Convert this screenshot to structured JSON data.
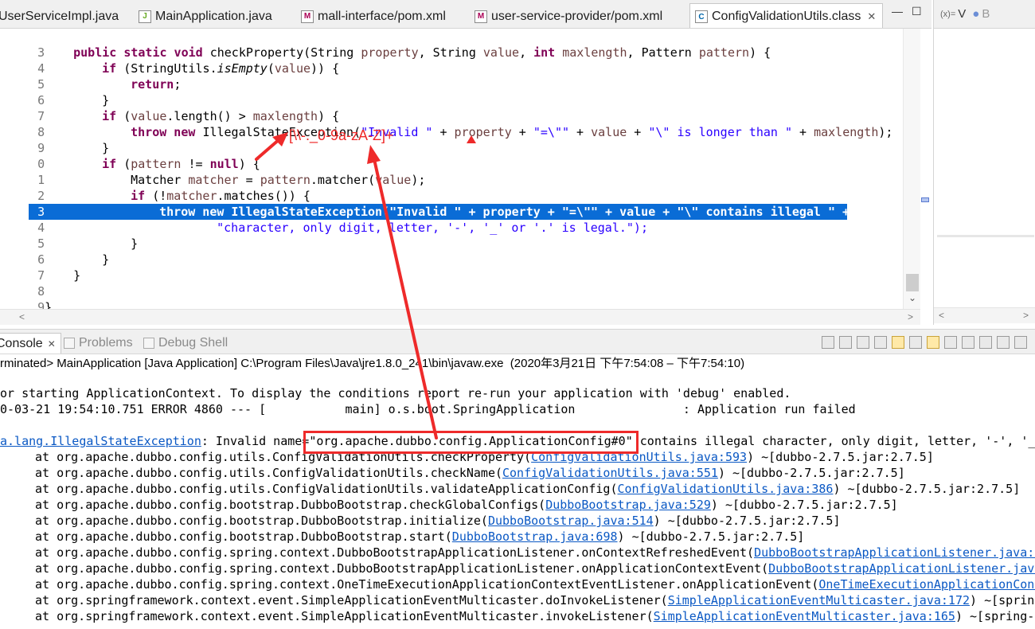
{
  "editor_tabs": [
    {
      "label": "UserServiceImpl.java",
      "icon": "java-file-icon"
    },
    {
      "label": "MainApplication.java",
      "icon": "java-file-icon"
    },
    {
      "label": "mall-interface/pom.xml",
      "icon": "xml-file-icon"
    },
    {
      "label": "user-service-provider/pom.xml",
      "icon": "xml-file-icon"
    },
    {
      "label": "ConfigValidationUtils.class",
      "icon": "class-file-icon",
      "active": true
    }
  ],
  "right_panel": {
    "tabs": [
      {
        "label": "V",
        "icon": "variables-icon"
      },
      {
        "label": "B",
        "icon": "breakpoints-icon"
      }
    ]
  },
  "code": {
    "line_numbers": [
      "3",
      "4",
      "5",
      "6",
      "7",
      "8",
      "9",
      "0",
      "1",
      "2",
      "3",
      "4",
      "5",
      "6",
      "7",
      "8",
      "9",
      ""
    ],
    "l0_a": "public static void ",
    "l0_b": "checkProperty(String ",
    "l0_c": "property",
    "l0_d": ", String ",
    "l0_e": "value",
    "l0_f": ", ",
    "l0_g": "int ",
    "l0_h": "maxlength",
    "l0_i": ", Pattern ",
    "l0_j": "pattern",
    "l0_k": ") {",
    "l1_a": "if ",
    "l1_b": "(StringUtils.",
    "l1_c": "isEmpty",
    "l1_d": "(",
    "l1_e": "value",
    "l1_f": ")) {",
    "l2_a": "return",
    "l2_b": ";",
    "l3": "}",
    "l4_a": "if ",
    "l4_b": "(",
    "l4_c": "value",
    "l4_d": ".length() > ",
    "l4_e": "maxlength",
    "l4_f": ") {",
    "l5_a": "throw new ",
    "l5_b": "IllegalStateException(",
    "l5_c": "\"Invalid \"",
    "l5_d": " + ",
    "l5_e": "property",
    "l5_f": " + ",
    "l5_g": "\"=\\\"\"",
    "l5_h": " + ",
    "l5_i": "value",
    "l5_j": " + ",
    "l5_k": "\"\\\" is longer than \"",
    "l5_l": " + ",
    "l5_m": "maxlength",
    "l5_n": ");",
    "l6": "}",
    "l7_a": "if ",
    "l7_b": "(",
    "l7_c": "pattern",
    "l7_d": " != ",
    "l7_e": "null",
    "l7_f": ") {",
    "l8_a": "Matcher ",
    "l8_b": "matcher",
    "l8_c": " = ",
    "l8_d": "pattern",
    "l8_e": ".matcher(",
    "l8_f": "value",
    "l8_g": ");",
    "l9_a": "if ",
    "l9_b": "(!",
    "l9_c": "matcher",
    "l9_d": ".matches()) {",
    "l10": "throw new IllegalStateException(\"Invalid \" + property + \"=\\\"\" + value + \"\\\" contains illegal \" +",
    "l11": "\"character, only digit, letter, '-', '_' or '.' is legal.\");",
    "l12": "}",
    "l13": "}",
    "l14": "}",
    "l15": "",
    "l16": "}"
  },
  "annotation": {
    "regex": "[\\\\-._0-9a-zA-Z]+",
    "color": "#ee2a2a"
  },
  "console": {
    "tabs": [
      {
        "label": "Console",
        "active": true,
        "icon": "console-icon"
      },
      {
        "label": "Problems",
        "icon": "problems-icon"
      },
      {
        "label": "Debug Shell",
        "icon": "debug-shell-icon"
      }
    ],
    "terminated": "rminated> MainApplication [Java Application] C:\\Program Files\\Java\\jre1.8.0_241\\bin\\javaw.exe  (2020年3月21日 下午7:54:08 – 下午7:54:10)",
    "line1": "or starting ApplicationContext. To display the conditions report re-run your application with 'debug' enabled.",
    "line2": "0-03-21 19:54:10.751 ERROR 4860 --- [           main] o.s.boot.SpringApplication               : Application run failed",
    "ex_link": "a.lang.IllegalStateException",
    "ex_text": ": Invalid name=",
    "ex_name": "\"org.apache.dubbo.config.ApplicationConfig#0\"",
    "ex_rest": " contains illegal character, only digit, letter, '-', '_'",
    "stack": [
      {
        "pre": "at org.apache.dubbo.config.utils.ConfigValidationUtils.checkProperty(",
        "link": "ConfigValidationUtils.java:593",
        "post": ") ~[dubbo-2.7.5.jar:2.7.5]"
      },
      {
        "pre": "at org.apache.dubbo.config.utils.ConfigValidationUtils.checkName(",
        "link": "ConfigValidationUtils.java:551",
        "post": ") ~[dubbo-2.7.5.jar:2.7.5]"
      },
      {
        "pre": "at org.apache.dubbo.config.utils.ConfigValidationUtils.validateApplicationConfig(",
        "link": "ConfigValidationUtils.java:386",
        "post": ") ~[dubbo-2.7.5.jar:2.7.5]"
      },
      {
        "pre": "at org.apache.dubbo.config.bootstrap.DubboBootstrap.checkGlobalConfigs(",
        "link": "DubboBootstrap.java:529",
        "post": ") ~[dubbo-2.7.5.jar:2.7.5]"
      },
      {
        "pre": "at org.apache.dubbo.config.bootstrap.DubboBootstrap.initialize(",
        "link": "DubboBootstrap.java:514",
        "post": ") ~[dubbo-2.7.5.jar:2.7.5]"
      },
      {
        "pre": "at org.apache.dubbo.config.bootstrap.DubboBootstrap.start(",
        "link": "DubboBootstrap.java:698",
        "post": ") ~[dubbo-2.7.5.jar:2.7.5]"
      },
      {
        "pre": "at org.apache.dubbo.config.spring.context.DubboBootstrapApplicationListener.onContextRefreshedEvent(",
        "link": "DubboBootstrapApplicationListener.java:5",
        "post": ""
      },
      {
        "pre": "at org.apache.dubbo.config.spring.context.DubboBootstrapApplicationListener.onApplicationContextEvent(",
        "link": "DubboBootstrapApplicationListener.java",
        "post": ""
      },
      {
        "pre": "at org.apache.dubbo.config.spring.context.OneTimeExecutionApplicationContextEventListener.onApplicationEvent(",
        "link": "OneTimeExecutionApplicationConte",
        "post": ""
      },
      {
        "pre": "at org.springframework.context.event.SimpleApplicationEventMulticaster.doInvokeListener(",
        "link": "SimpleApplicationEventMulticaster.java:172",
        "post": ") ~[spring"
      },
      {
        "pre": "at org.springframework.context.event.SimpleApplicationEventMulticaster.invokeListener(",
        "link": "SimpleApplicationEventMulticaster.java:165",
        "post": ") ~[spring-c"
      }
    ]
  }
}
